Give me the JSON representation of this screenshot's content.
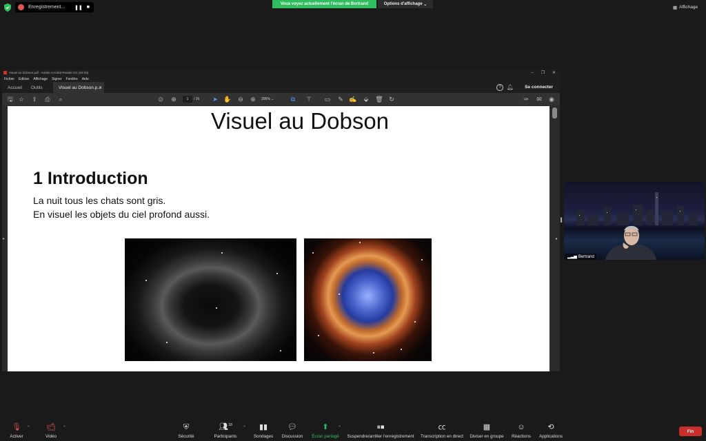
{
  "zoom_top": {
    "recording_label": "Enregistrement...",
    "share_banner": "Vous voyez actuellement l'écran de Bertrand",
    "view_options": "Options d'affichage",
    "view_label": "Affichage"
  },
  "acrobat": {
    "title": "Visuel au Dobson.pdf - Adobe Acrobat Reader DC (64-bit)",
    "menu": [
      "Fichier",
      "Edition",
      "Affichage",
      "Signer",
      "Fenêtre",
      "Aide"
    ],
    "tabs": {
      "home": "Accueil",
      "tools": "Outils",
      "doc": "Visuel au Dobson.p..."
    },
    "connect": "Se connecter",
    "page_current": "1",
    "page_total": "/ 36",
    "zoom": "205%"
  },
  "document": {
    "title": "Visuel au Dobson",
    "section": "1 Introduction",
    "paragraph_1": "La nuit tous les chats sont gris.",
    "paragraph_2": "En visuel les objets du ciel profond aussi."
  },
  "participant": {
    "name": "Bertrand"
  },
  "toolbar": {
    "mute": "Activer",
    "video": "Vidéo",
    "security": "Sécurité",
    "participants": "Participants",
    "participants_count": "18",
    "polls": "Sondages",
    "chat": "Discussion",
    "share": "Écran partagé",
    "record": "Suspendre/arrêter l'enregistrement",
    "transcription": "Transcription en direct",
    "breakout": "Diviser en groupe",
    "reactions": "Réactions",
    "apps": "Applications",
    "end": "Fin"
  },
  "colors": {
    "share_green": "#2fbd5f",
    "end_red": "#c9302c"
  }
}
